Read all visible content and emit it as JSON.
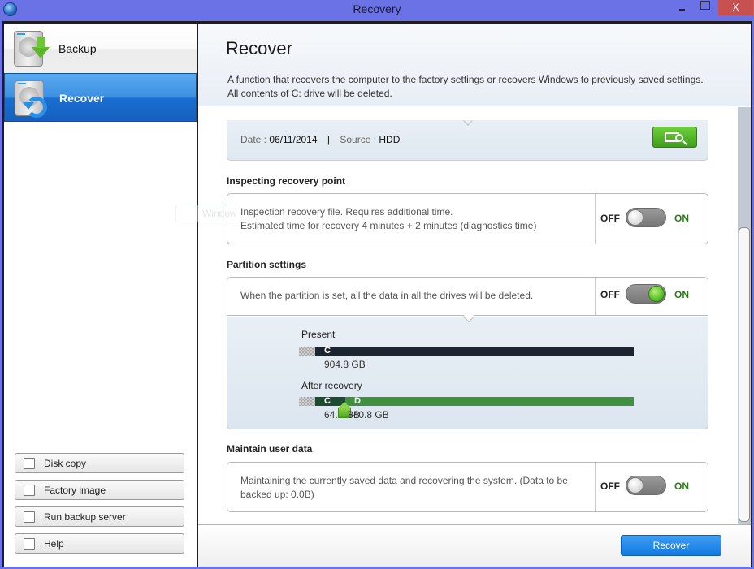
{
  "window": {
    "title": "Recovery",
    "close_label": "X"
  },
  "sidebar": {
    "items": [
      {
        "label": "Backup",
        "icon": "hdd-download-icon",
        "selected": false
      },
      {
        "label": "Recover",
        "icon": "hdd-restore-icon",
        "selected": true
      }
    ],
    "buttons": [
      {
        "label": "Disk copy",
        "icon": "disk-copy-icon"
      },
      {
        "label": "Factory image",
        "icon": "factory-image-icon"
      },
      {
        "label": "Run backup server",
        "icon": "backup-server-icon"
      },
      {
        "label": "Help",
        "icon": "help-icon"
      }
    ]
  },
  "header": {
    "title": "Recover",
    "description_line1": "A function that recovers the computer to the factory settings or recovers Windows to previously saved settings.",
    "description_line2": "All contents of C: drive will be deleted."
  },
  "recovery_point": {
    "date_label": "Date :",
    "date_value": "06/11/2014",
    "separator": "|",
    "source_label": "Source :",
    "source_value": "HDD",
    "inspect_button_icon": "monitor-search-icon"
  },
  "ghost_tooltip": "Window",
  "sections": {
    "inspecting": {
      "title": "Inspecting recovery point",
      "line1": "Inspection recovery file. Requires additional time.",
      "line2": "Estimated time for recovery 4 minutes + 2 minutes (diagnostics time)",
      "off_label": "OFF",
      "on_label": "ON",
      "state": "off"
    },
    "partition": {
      "title": "Partition settings",
      "text": "When the partition is set, all the data in all the drives will be deleted.",
      "off_label": "OFF",
      "on_label": "ON",
      "state": "on",
      "present_label": "Present",
      "present_drive": "C",
      "present_size": "904.8 GB",
      "after_label": "After recovery",
      "after_c_drive": "C",
      "after_c_size": "64.0 GB",
      "after_d_drive": "D",
      "after_d_size": "840.8 GB",
      "split_fraction": 0.0707
    },
    "maintain": {
      "title": "Maintain user data",
      "line1": "Maintaining the currently saved data and recovering the system. (Data to be",
      "line2": "backed up: 0.0B)",
      "off_label": "OFF",
      "on_label": "ON",
      "state": "off"
    }
  },
  "footer": {
    "recover_button": "Recover"
  },
  "colors": {
    "titlebar": "#6b72e5",
    "selected_nav": "#1a6fd0",
    "on_green": "#2a7d14",
    "drive_c_after": "#1f4a32",
    "drive_d_after": "#3f9140",
    "drive_present": "#1d2630",
    "primary_button": "#1479e0"
  }
}
